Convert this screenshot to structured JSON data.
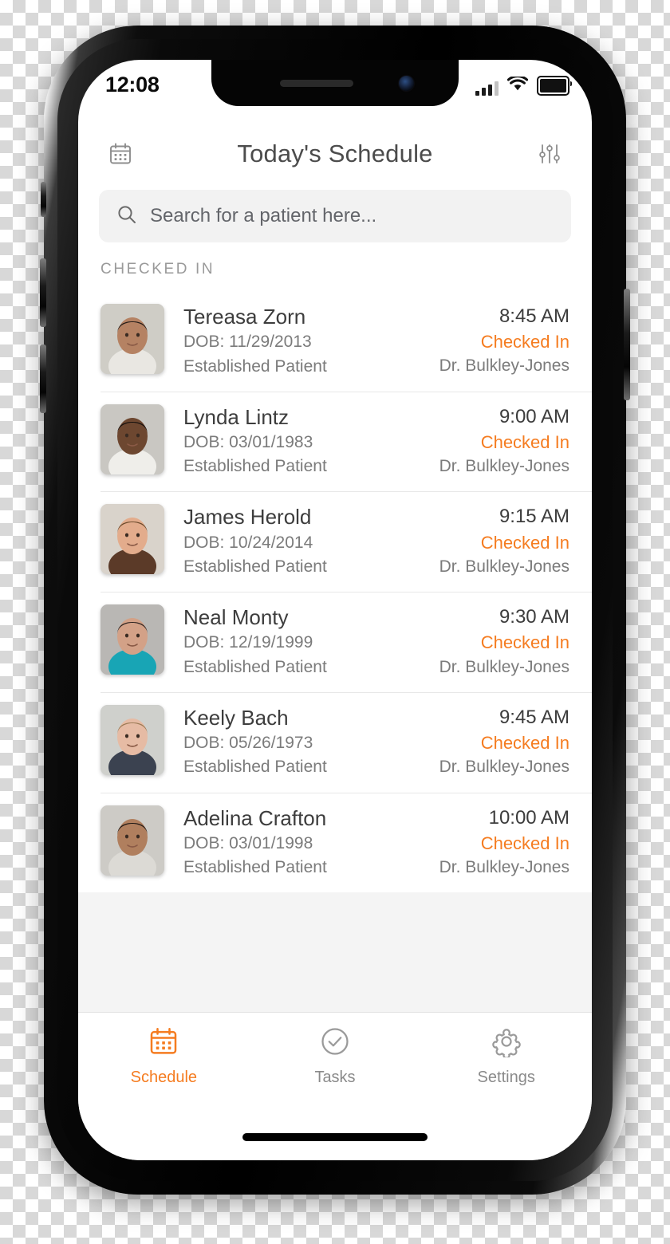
{
  "status_bar": {
    "time": "12:08",
    "signal_icon": "signal-bars-icon",
    "wifi_icon": "wifi-icon",
    "battery_icon": "battery-full-icon"
  },
  "header": {
    "title": "Today's Schedule",
    "left_icon": "calendar-icon",
    "right_icon": "filter-sliders-icon"
  },
  "search": {
    "placeholder": "Search for a patient here...",
    "value": "",
    "icon": "search-icon"
  },
  "section": {
    "label": "CHECKED IN"
  },
  "colors": {
    "accent": "#f57c20",
    "title_text": "#4c4c4c",
    "primary_text": "#3d3d3d",
    "secondary_text": "#7b7b7b",
    "search_background": "#f2f2f2",
    "list_background": "#f4f4f4",
    "divider": "#e8e8e8"
  },
  "patients": [
    {
      "name": "Tereasa Zorn",
      "dob": "DOB: 11/29/2013",
      "type": "Established Patient",
      "time": "8:45 AM",
      "status": "Checked In",
      "doctor": "Dr. Bulkley-Jones"
    },
    {
      "name": "Lynda Lintz",
      "dob": "DOB: 03/01/1983",
      "type": "Established Patient",
      "time": "9:00 AM",
      "status": "Checked In",
      "doctor": "Dr. Bulkley-Jones"
    },
    {
      "name": "James Herold",
      "dob": "DOB: 10/24/2014",
      "type": "Established Patient",
      "time": "9:15 AM",
      "status": "Checked In",
      "doctor": "Dr. Bulkley-Jones"
    },
    {
      "name": "Neal Monty",
      "dob": "DOB: 12/19/1999",
      "type": "Established Patient",
      "time": "9:30 AM",
      "status": "Checked In",
      "doctor": "Dr. Bulkley-Jones"
    },
    {
      "name": "Keely Bach",
      "dob": "DOB: 05/26/1973",
      "type": "Established Patient",
      "time": "9:45 AM",
      "status": "Checked In",
      "doctor": "Dr. Bulkley-Jones"
    },
    {
      "name": "Adelina Crafton",
      "dob": "DOB: 03/01/1998",
      "type": "Established Patient",
      "time": "10:00 AM",
      "status": "Checked In",
      "doctor": "Dr. Bulkley-Jones"
    }
  ],
  "tabs": [
    {
      "label": "Schedule",
      "icon": "calendar-icon",
      "active": true
    },
    {
      "label": "Tasks",
      "icon": "check-circle-icon",
      "active": false
    },
    {
      "label": "Settings",
      "icon": "gear-icon",
      "active": false
    }
  ]
}
